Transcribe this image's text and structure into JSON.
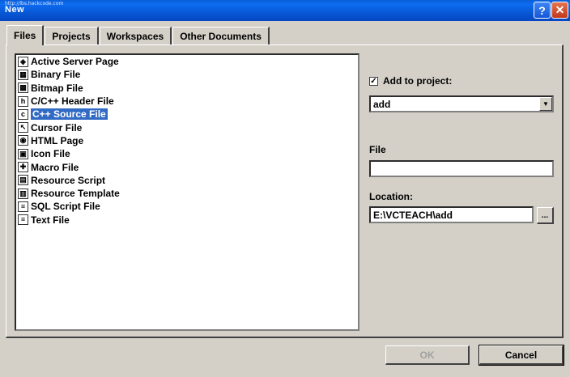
{
  "window": {
    "title": "New",
    "watermark": "http://lbs.hackcode.com",
    "help_glyph": "?",
    "close_glyph": "✕"
  },
  "tabs": [
    {
      "label": "Files",
      "active": true
    },
    {
      "label": "Projects"
    },
    {
      "label": "Workspaces"
    },
    {
      "label": "Other Documents"
    }
  ],
  "files": [
    {
      "label": "Active Server Page",
      "icon": "asp-file-icon",
      "glyph": "◈"
    },
    {
      "label": "Binary File",
      "icon": "binary-file-icon",
      "glyph": "▦"
    },
    {
      "label": "Bitmap File",
      "icon": "bitmap-file-icon",
      "glyph": "▩"
    },
    {
      "label": "C/C++ Header File",
      "icon": "header-file-icon",
      "glyph": "h"
    },
    {
      "label": "C++ Source File",
      "icon": "source-file-icon",
      "glyph": "c",
      "selected": true
    },
    {
      "label": "Cursor File",
      "icon": "cursor-file-icon",
      "glyph": "↖"
    },
    {
      "label": "HTML Page",
      "icon": "html-page-icon",
      "glyph": "◉"
    },
    {
      "label": "Icon File",
      "icon": "icon-file-icon",
      "glyph": "▣"
    },
    {
      "label": "Macro File",
      "icon": "macro-file-icon",
      "glyph": "✚"
    },
    {
      "label": "Resource Script",
      "icon": "resource-script-icon",
      "glyph": "▤"
    },
    {
      "label": "Resource Template",
      "icon": "resource-template-icon",
      "glyph": "▥"
    },
    {
      "label": "SQL Script File",
      "icon": "sql-file-icon",
      "glyph": "≡"
    },
    {
      "label": "Text File",
      "icon": "text-file-icon",
      "glyph": "≡"
    }
  ],
  "add_to_project": {
    "label": "Add to project:",
    "checked": true,
    "check_glyph": "✓",
    "project": "add",
    "arrow_glyph": "▼"
  },
  "file_field": {
    "label": "File",
    "value": ""
  },
  "location_field": {
    "label": "Location:",
    "value": "E:\\VCTEACH\\add",
    "browse_label": "..."
  },
  "buttons": {
    "ok": "OK",
    "cancel": "Cancel"
  }
}
